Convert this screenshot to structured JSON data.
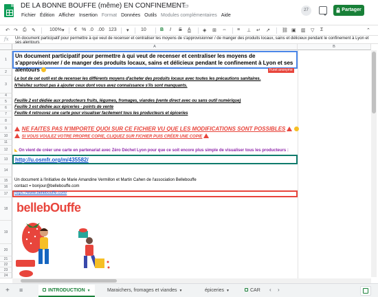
{
  "header": {
    "title": "DE LA BONNE BOUFFE (même) EN CONFINEMENT",
    "menu": [
      "Fichier",
      "Édition",
      "Afficher",
      "Insertion",
      "Format",
      "Données",
      "Outils",
      "Modules complémentaires",
      "Aide"
    ],
    "avatar_count": "27",
    "share_label": "Partager"
  },
  "toolbar": {
    "zoom": "100%",
    "number_format": "123",
    "font_size": "10",
    "bold": "B",
    "italic": "I",
    "strikethrough": "S",
    "text_color": "A",
    "currency": "€",
    "percent": "%",
    "decimals_less": ".0",
    "decimals_more": ".00",
    "functions": "Σ"
  },
  "formula_bar": {
    "fx": "fx",
    "content": "Un document participatif pour permettre à qui veut de recenser et centraliser les moyens de s'approvisionner / de manger des produits locaux, sains et délicieux pendant le confinement à Lyon et ses alentours"
  },
  "grid": {
    "column_a": "A",
    "column_b": "B",
    "row_numbers": [
      "1",
      "2",
      "3",
      "4",
      "5",
      "6",
      "7",
      "8",
      "9",
      "10",
      "11",
      "12",
      "13",
      "14",
      "15",
      "16",
      "17",
      "18",
      "19",
      "20",
      "21",
      "22",
      "23",
      "24",
      "25",
      "26"
    ],
    "r1": "Un document participatif pour permettre à qui veut de recenser et centraliser les moyens de s'approvisionner / de manger des produits locaux, sains et délicieux pendant le confinement à Lyon et ses alentours",
    "anonymous_tag": "Furet anonyme",
    "r3a": "Le but de cet outil est de recenser les différents moyens d'acheter des produits locaux avec toutes les précautions sanitaires.",
    "r3b": "N'hésitez surtout pas à ajouter ceux dont vous avez connaissance s'ils sont manquants.",
    "r5": "Feuille 2 est dédiée aux producteurs fruits, légumes, fromages, viandes (vente direct avec ou sans outil numérique)",
    "r6": "Feuille 3 est dédiée aux épiceries - points de vente",
    "r7": "Feuille 4 retrouvez une carte pour visualiser facilement tous les producteurs et épiceries",
    "r9": "NE FAITES PAS N'IMPORTE QUOI SUR CE FICHIER VU QUE LES MODIFICATIONS SONT POSSIBLES",
    "r10": "SI VOUS VOULEZ VOTRE PROPRE COPIE, CLIQUEZ SUR FICHIER PUIS CRÉER UNE COPIE",
    "r12": "On vient de créer une carte en partenariat avec Zéro Déchet Lyon pour que ce soit encore plus simple de visualiser tous les producteurs :",
    "r13": "http://u.osmfr.org/m/435582/",
    "r15": "Un document à l'initiative de Marie Amandine Vermillon et Martin Cahen de l'association Bellebouffe",
    "r16": "contact = bonjour@bellebouffe.com",
    "r17": "https://www.bellebouffe.com/",
    "logo": "bellebOuffe"
  },
  "sheets": {
    "tabs": [
      "INTRODUCTION",
      "Maraichers, fromages et viandes",
      "épiceries",
      "CAR"
    ]
  },
  "colors": {
    "brand_green": "#188038",
    "accent_red": "#e8453c",
    "selection_blue": "#4a86e8",
    "link_blue": "#1155cc",
    "purple": "#8e24aa"
  }
}
